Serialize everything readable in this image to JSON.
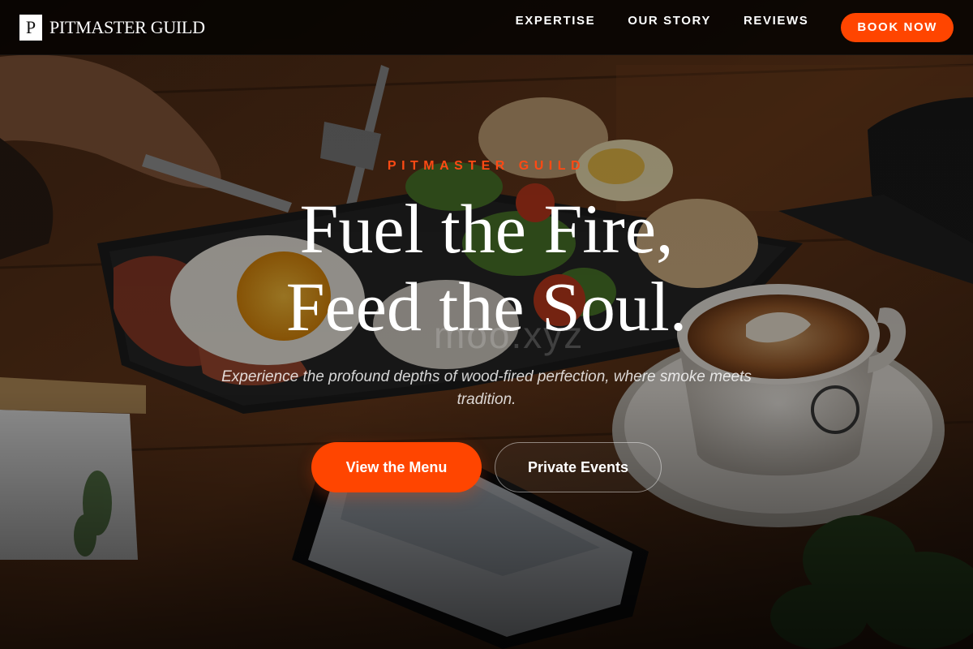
{
  "brand": {
    "mark": "P",
    "name": "PITMASTER GUILD"
  },
  "nav": {
    "items": [
      {
        "label": "EXPERTISE"
      },
      {
        "label": "OUR STORY"
      },
      {
        "label": "REVIEWS"
      }
    ],
    "cta_label": "BOOK NOW"
  },
  "hero": {
    "eyebrow": "PITMASTER GUILD",
    "headline_line1": "Fuel the Fire,",
    "headline_line2": "Feed the Soul.",
    "watermark": "moo.xyz",
    "subtext": "Experience the profound depths of wood-fired perfection, where smoke meets tradition.",
    "primary_cta": "View the Menu",
    "secondary_cta": "Private Events",
    "background_image": "breakfast-and-latte-photo"
  },
  "colors": {
    "accent": "#ff4500",
    "header_bg": "#000000",
    "text": "#ffffff"
  }
}
